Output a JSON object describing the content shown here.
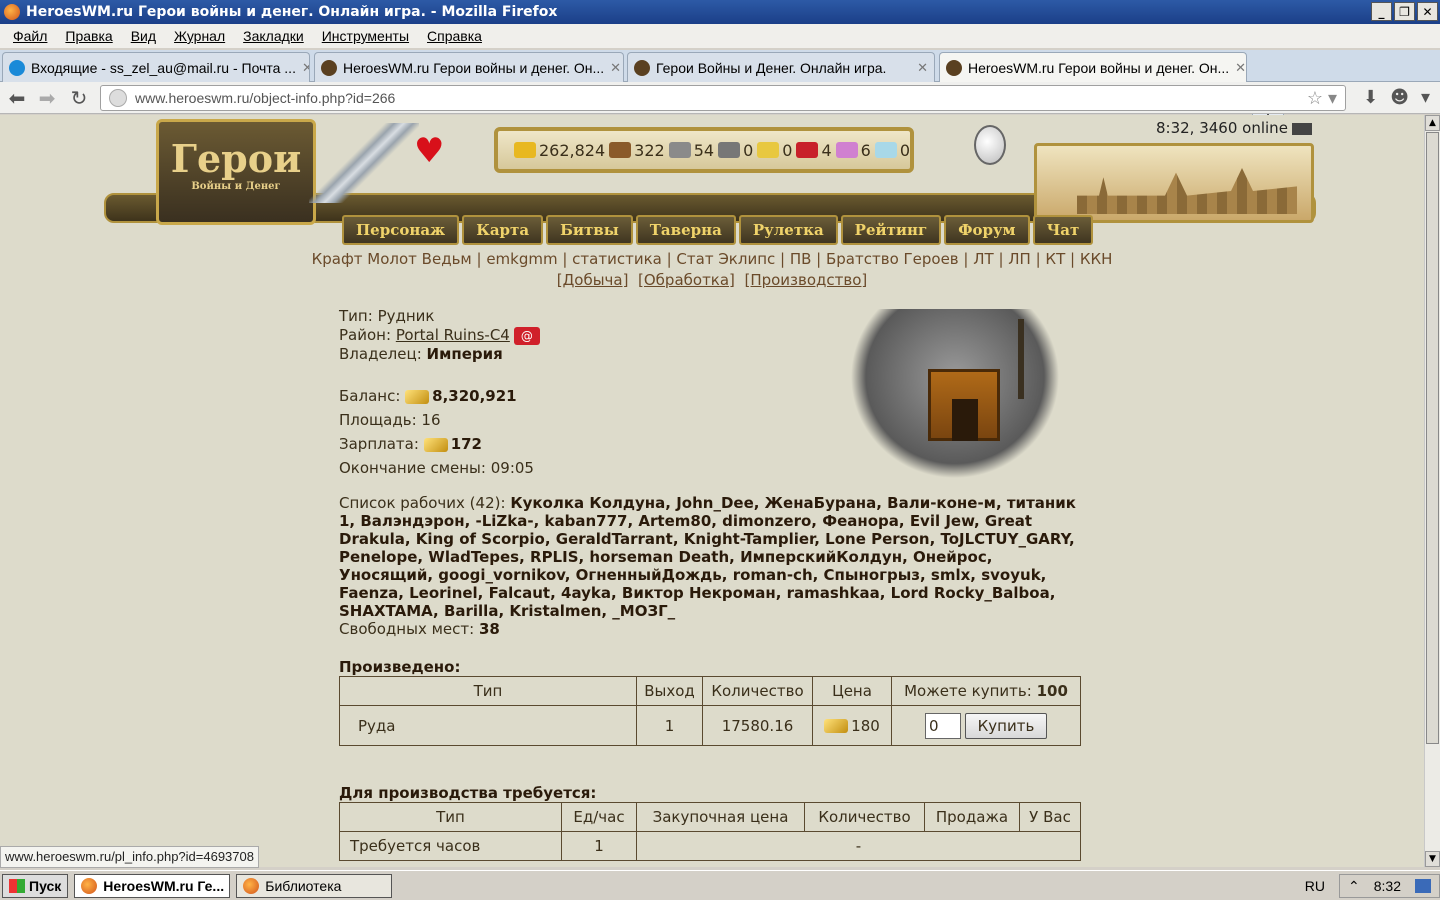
{
  "window": {
    "title": "HeroesWM.ru Герои войны и денег. Онлайн игра. - Mozilla Firefox"
  },
  "menu": [
    "Файл",
    "Правка",
    "Вид",
    "Журнал",
    "Закладки",
    "Инструменты",
    "Справка"
  ],
  "tabs": [
    {
      "label": "Входящие - ss_zel_au@mail.ru - Почта ...",
      "close": "✕"
    },
    {
      "label": "HeroesWM.ru Герои войны и денег. Он...",
      "close": "✕"
    },
    {
      "label": "Герои Войны и Денег. Онлайн игра.",
      "close": "✕"
    },
    {
      "label": "HeroesWM.ru Герои войны и денег. Он...",
      "close": "✕"
    }
  ],
  "newtab": "+",
  "url": {
    "host": "www.heroeswm.ru",
    "path": "/object-info.php?id=266"
  },
  "game": {
    "logo_big": "Герои",
    "logo_small": "Войны и Денег",
    "online": "8:32, 3460 online",
    "resources": [
      {
        "icon": "gold-icon",
        "value": "262,824",
        "color": "#e8b820"
      },
      {
        "icon": "wood-icon",
        "value": "322",
        "color": "#8a5a2a"
      },
      {
        "icon": "ore-icon",
        "value": "54",
        "color": "#8a8a8a"
      },
      {
        "icon": "mercury-icon",
        "value": "0",
        "color": "#777777"
      },
      {
        "icon": "sulfur-icon",
        "value": "0",
        "color": "#e8c840"
      },
      {
        "icon": "crystal-icon",
        "value": "4",
        "color": "#c8202a"
      },
      {
        "icon": "gems-icon",
        "value": "6",
        "color": "#d080d0"
      },
      {
        "icon": "diamond-icon",
        "value": "0",
        "color": "#a8d8e8"
      }
    ],
    "nav": [
      "Персонаж",
      "Карта",
      "Битвы",
      "Таверна",
      "Рулетка",
      "Рейтинг",
      "Форум",
      "Чат"
    ],
    "sublinks": "Крафт Молот Ведьм | emkgmm | статистика | Стат Эклипс | ПВ | Братство Героев | ЛТ | ЛП | КТ | ККН",
    "sublinks2": [
      "[Добыча]",
      "[Обработка]",
      "[Производство]"
    ]
  },
  "object": {
    "type_label": "Тип:",
    "type_value": "Рудник",
    "district_label": "Район:",
    "district_value": "Portal Ruins-C4",
    "mail_badge": "@",
    "owner_label": "Владелец:",
    "owner_value": "Империя",
    "balance_label": "Баланс:",
    "balance_value": "8,320,921",
    "area_label": "Площадь:",
    "area_value": "16",
    "salary_label": "Зарплата:",
    "salary_value": "172",
    "shift_label": "Окончание смены:",
    "shift_value": "09:05",
    "workers_label": "Список рабочих (42):",
    "workers": "Куколка Колдуна, John_Dee, ЖенаБурана, Вали-коне-м, титаник 1, Валэндэрон, -LiZka-, kaban777, Artem80, dimonzero, Феанора, Evil Jew, Great Drakula, King of Scorpio, GeraldTarrant, Knight-Tamplier, Lone Person, ToJLCTUY_GARY, Penelope, WladTepes, RPLIS, horseman Death, ИмперскийКолдун, Онейрос, Уносящий, googi_vornikov, ОгненныйДождь, roman-ch, Спыногрыз, smlx, svoyuk, Faenza, Leorinel, Falcaut, 4ayka, Виктор Некроман, ramashkaa, Lord Rocky_Balboa, SHAXTAMA, Barilla, Kristalmen, _МОЗГ_",
    "free_label": "Свободных мест:",
    "free_value": "38"
  },
  "produced": {
    "title": "Произведено:",
    "headers": [
      "Тип",
      "Выход",
      "Количество",
      "Цена",
      "Можете купить:"
    ],
    "can_buy": "100",
    "row": {
      "type": "Руда",
      "output": "1",
      "qty": "17580.16",
      "price": "180",
      "input_value": "0",
      "buy_label": "Купить"
    }
  },
  "required": {
    "title": "Для производства требуется:",
    "headers": [
      "Тип",
      "Ед/час",
      "Закупочная цена",
      "Количество",
      "Продажа",
      "У Вас"
    ],
    "row": {
      "type": "Требуется часов",
      "per_hour": "1",
      "rest": "-"
    }
  },
  "status_url": "www.heroeswm.ru/pl_info.php?id=4693708",
  "taskbar": {
    "start": "Пуск",
    "items": [
      "HeroesWM.ru Ге...",
      "Библиотека"
    ],
    "lang": "RU",
    "clock": "8:32"
  }
}
